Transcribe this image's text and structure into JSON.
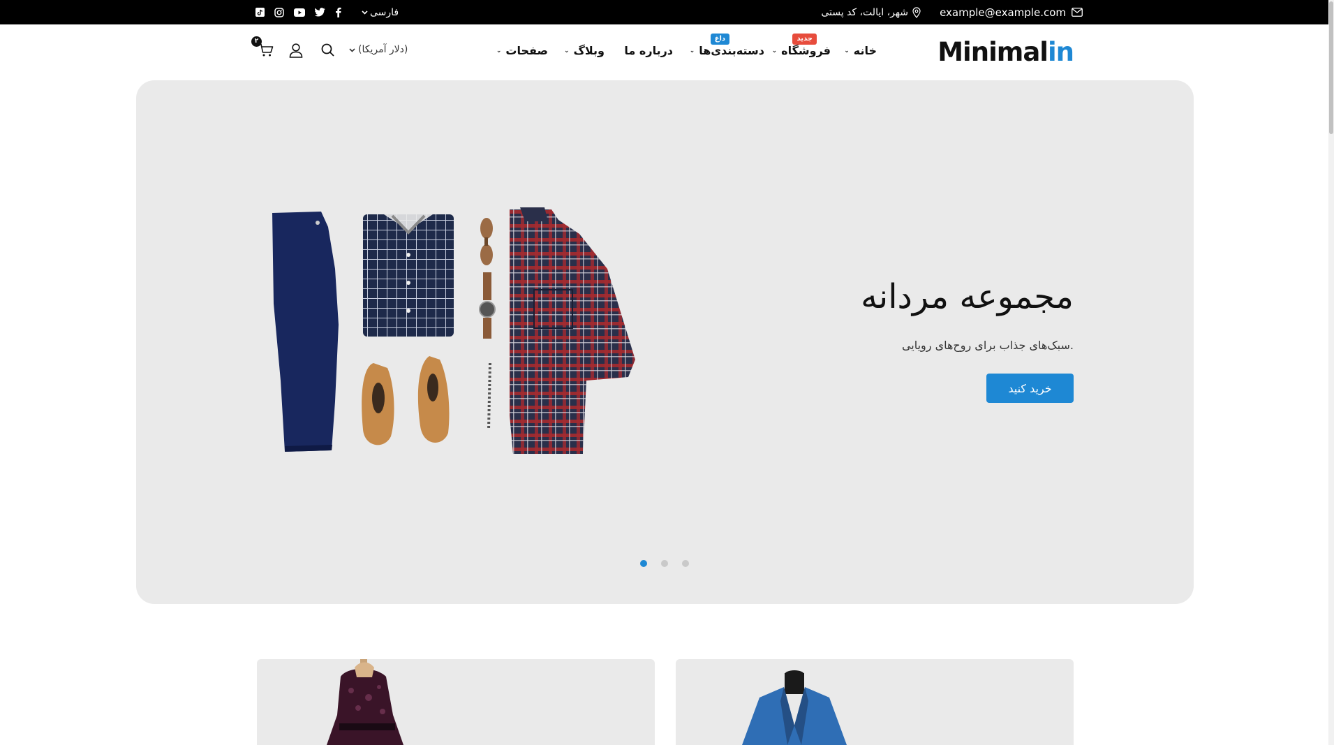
{
  "topbar": {
    "email": "example@example.com",
    "address": "شهر، ایالت، کد پستی",
    "language": "فارسی",
    "social_icons": [
      "mail-icon",
      "location-icon",
      "facebook-icon",
      "twitter-icon",
      "youtube-icon",
      "instagram-icon",
      "tiktok-icon"
    ]
  },
  "header": {
    "logo_main": "Minimal",
    "logo_accent": "in",
    "nav": [
      {
        "label": "خانه"
      },
      {
        "label": "فروشگاه",
        "badge": "جدید"
      },
      {
        "label": "دسته‌بندی‌ها",
        "badge": "داغ"
      },
      {
        "label": "درباره ما"
      },
      {
        "label": "وبلاگ"
      },
      {
        "label": "صفحات"
      }
    ],
    "currency": "(دلار آمریکا)",
    "cart_count": "۲"
  },
  "hero": {
    "title": "مجموعه مردانه",
    "subtitle": ".سبک‌های جذاب برای روح‌های رویایی",
    "button": "خرید کنید",
    "slides": 3,
    "active_slide": 1
  },
  "colors": {
    "accent": "#1e88d4",
    "badge_new": "#e74c3c",
    "badge_hot": "#1e88d4",
    "topbar_bg": "#000000",
    "hero_bg": "#eaeaea"
  }
}
